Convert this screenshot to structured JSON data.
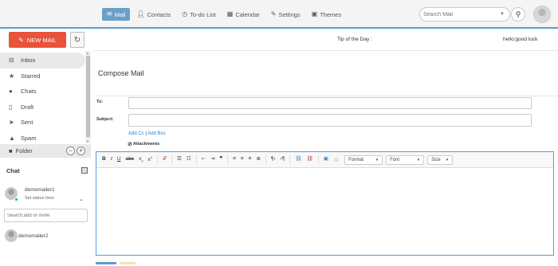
{
  "nav": {
    "items": [
      {
        "label": "Mail",
        "icon": "envelope-icon"
      },
      {
        "label": "Contacts",
        "icon": "person-icon"
      },
      {
        "label": "To-do List",
        "icon": "clock-icon"
      },
      {
        "label": "Calendar",
        "icon": "calendar-icon"
      },
      {
        "label": "Settings",
        "icon": "wrench-icon"
      },
      {
        "label": "Themes",
        "icon": "image-icon"
      }
    ],
    "active": "Mail"
  },
  "search": {
    "placeholder": "Search Mail"
  },
  "toolbar": {
    "new_mail": "NEW MAIL"
  },
  "tip": {
    "label": "Tip of the Day :",
    "text": "hello:good luck"
  },
  "sidebar": {
    "folders": [
      {
        "label": "Inbox",
        "icon": "inbox-icon"
      },
      {
        "label": "Starred",
        "icon": "star-icon"
      },
      {
        "label": "Chats",
        "icon": "chat-bubbles-icon"
      },
      {
        "label": "Draft",
        "icon": "document-icon"
      },
      {
        "label": "Sent",
        "icon": "paper-plane-icon"
      },
      {
        "label": "Spam",
        "icon": "warning-icon"
      }
    ],
    "folder_label": "Folder"
  },
  "chat": {
    "title": "Chat",
    "user": {
      "name": "demomailer1",
      "status": "Set status here"
    },
    "search_placeholder": "Search,add or invite",
    "contacts": [
      {
        "name": "demomailer2"
      }
    ]
  },
  "compose": {
    "title": "Compose Mail",
    "to_label": "To:",
    "subject_label": "Subject:",
    "add_cc": "Add Cc",
    "add_bcc": "Add Bcc",
    "attachments": "Attachments",
    "to_value": "",
    "subject_value": ""
  },
  "editor": {
    "format_label": "Format",
    "font_label": "Font",
    "size_label": "Size"
  },
  "colors": {
    "accent": "#5b9bd5",
    "new_mail": "#e8533a",
    "nav_active": "#6b9fc9",
    "online": "#2db34a",
    "link": "#2a7fc9"
  }
}
